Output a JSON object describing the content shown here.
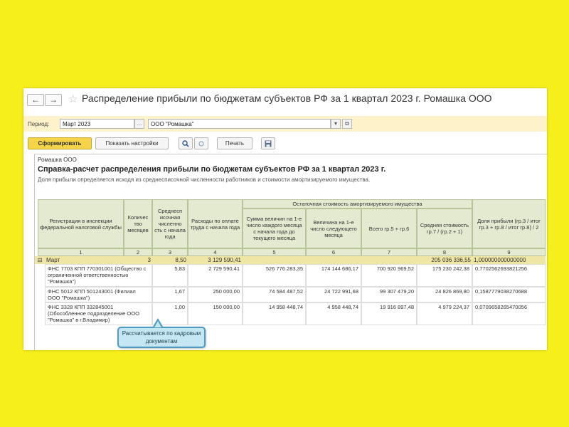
{
  "window": {
    "title": "Распределение прибыли по бюджетам субъектов РФ за 1 квартал 2023 г. Ромашка ООО",
    "back_icon": "←",
    "forward_icon": "→",
    "star_icon": "☆"
  },
  "params": {
    "period_label": "Период:",
    "period_value": "Март 2023",
    "period_select_icon": "...",
    "org_value": "ООО \"Ромашка\"",
    "org_dropdown_icon": "▾",
    "org_open_icon": "⧉"
  },
  "toolbar": {
    "generate_label": "Сформировать",
    "settings_label": "Показать настройки",
    "search_icon": "🔍",
    "print_label": "Печать",
    "save_icon": "💾"
  },
  "report": {
    "org": "Ромашка ООО",
    "title": "Справка-расчет распределения прибыли по бюджетам субъектов РФ за 1 квартал 2023 г.",
    "subtitle": "Доля прибыли определяется исходя из среднесписочной численности работников и стоимости амортизируемого имущества.",
    "headers": {
      "reg": "Регистрация в инспекции федеральной налоговой службы",
      "months": "Количес тво месяцев",
      "avg_count": "Среднесп исочная численно сть с начала года",
      "labor": "Расходы по оплате труда с начала года",
      "assets_group": "Остаточная стоимость амортизируемого имущества",
      "sum_first": "Сумма величин на 1-е число каждого месяца с начала года до текущего месяца",
      "next_month": "Величина на 1-е число следующего месяца",
      "total": "Всего гр.5 + гр.6",
      "avg_cost": "Средняя стоимость гр.7 / (гр.2 + 1)",
      "share": "Доля прибыли (гр.3 / итог гр.3 + гр.8 / итог гр.8) / 2"
    },
    "col_numbers": [
      "1",
      "2",
      "3",
      "4",
      "5",
      "6",
      "7",
      "8",
      "9"
    ],
    "total_row": {
      "toggle": "⊟",
      "label": "Март",
      "months": "3",
      "avg_count": "8,50",
      "labor": "3 129 590,41",
      "avg_cost": "205 036 336,55",
      "share": "1,000000000000000"
    },
    "rows": [
      {
        "reg": "ФНС 7703 КПП 770301001 (Общество с ограниченной ответственностью \"Ромашка\")",
        "avg_count": "5,83",
        "labor": "2 729 590,41",
        "sum_first": "526 776 283,35",
        "next_month": "174 144 686,17",
        "total": "700 920 969,52",
        "avg_cost": "175 230 242,38",
        "share": "0,7702562693821256"
      },
      {
        "reg": "ФНС 5012 КПП 501243001 (Филиал ООО \"Ромашка\")",
        "avg_count": "1,67",
        "labor": "250 000,00",
        "sum_first": "74 584 487,52",
        "next_month": "24 722 991,68",
        "total": "99 307 479,20",
        "avg_cost": "24 826 869,80",
        "share": "0,1587779038270688"
      },
      {
        "reg": "ФНС 3328 КПП 332845001 (Обособленное подразделение ООО \"Ромашка\" в г.Владимир)",
        "avg_count": "1,00",
        "labor": "150 000,00",
        "sum_first": "14 958 448,74",
        "next_month": "4 958 448,74",
        "total": "19 916 897,48",
        "avg_cost": "4 979 224,37",
        "share": "0,0709658265470056"
      }
    ]
  },
  "callout": "Рассчитывается по кадровым документам"
}
